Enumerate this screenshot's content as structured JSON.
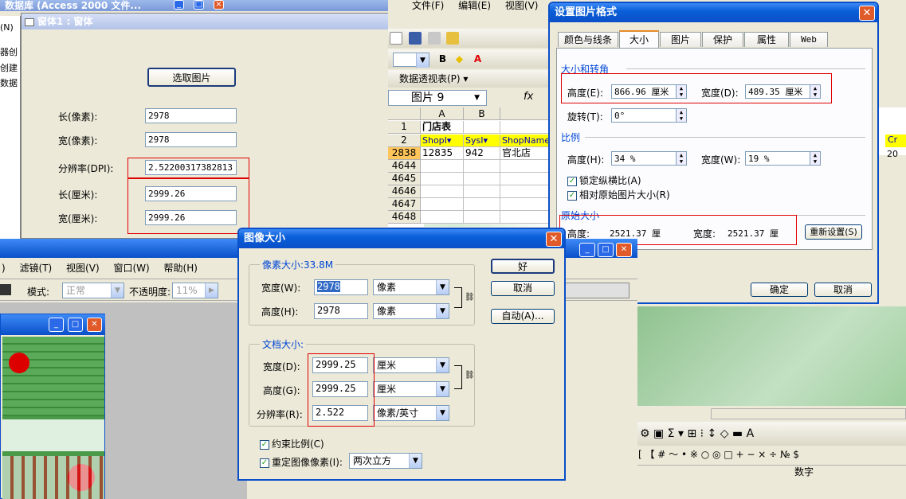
{
  "access_title": "数据库 (Access 2000 文件...",
  "access_left_menu": [
    "(N)",
    "器创",
    "创建",
    "数据"
  ],
  "form": {
    "title": "窗体1 : 窗体",
    "pick_button": "选取图片",
    "fields": [
      {
        "label": "长(像素):",
        "value": "2978"
      },
      {
        "label": "宽(像素):",
        "value": "2978"
      },
      {
        "label": "分辨率(DPI):",
        "value": "2.52200317382813"
      },
      {
        "label": "长(厘米):",
        "value": "2999.26"
      },
      {
        "label": "宽(厘米):",
        "value": "2999.26"
      }
    ]
  },
  "excel": {
    "menu": [
      "文件(F)",
      "编辑(E)",
      "视图(V)"
    ],
    "pivot_label": "数据透视表(P)",
    "name_box": "图片 9",
    "fx": "fx",
    "columns": [
      "A",
      "B"
    ],
    "rows": [
      {
        "num": "1",
        "cells": [
          "门店表",
          "",
          ""
        ]
      },
      {
        "num": "2",
        "cells": [
          "ShopI▾",
          "SysI▾",
          "ShopName"
        ]
      },
      {
        "num": "2838",
        "cells": [
          "12835",
          "942",
          "官北店"
        ]
      },
      {
        "num": "4644",
        "cells": [
          "",
          "",
          ""
        ]
      },
      {
        "num": "4645",
        "cells": [
          "",
          "",
          ""
        ]
      },
      {
        "num": "4646",
        "cells": [
          "",
          "",
          ""
        ]
      },
      {
        "num": "4647",
        "cells": [
          "",
          "",
          ""
        ]
      },
      {
        "num": "4648",
        "cells": [
          "",
          "",
          ""
        ]
      }
    ],
    "status": "数字",
    "right_header": "Cr",
    "right_val": "20"
  },
  "format_dialog": {
    "title": "设置图片格式",
    "tabs": [
      "颜色与线条",
      "大小",
      "图片",
      "保护",
      "属性",
      "Web"
    ],
    "active_tab": "大小",
    "size_group": "大小和转角",
    "height_label": "高度(E):",
    "height_value": "866.96 厘米",
    "width_label": "宽度(D):",
    "width_value": "489.35 厘米",
    "rotate_label": "旋转(T):",
    "rotate_value": "0°",
    "scale_group": "比例",
    "scale_height_label": "高度(H):",
    "scale_height_value": "34 %",
    "scale_width_label": "宽度(W):",
    "scale_width_value": "19 %",
    "lock_ratio": "锁定纵横比(A)",
    "relative_orig": "相对原始图片大小(R)",
    "orig_group": "原始大小",
    "orig_height_label": "高度:",
    "orig_height_value": "2521.37 厘",
    "orig_width_label": "宽度:",
    "orig_width_value": "2521.37 厘",
    "reset_button": "重新设置(S)",
    "ok_button": "确定",
    "cancel_button": "取消"
  },
  "ps": {
    "menu": [
      ")",
      "滤镜(T)",
      "视图(V)",
      "窗口(W)",
      "帮助(H)"
    ],
    "mode_label": "模式:",
    "mode_value": "正常",
    "opacity_label": "不透明度:",
    "opacity_value": "11%"
  },
  "image_dialog": {
    "title": "图像大小",
    "pixel_group": "像素大小:33.8M",
    "px_width_label": "宽度(W):",
    "px_width_value": "2978",
    "px_width_unit": "像素",
    "px_height_label": "高度(H):",
    "px_height_value": "2978",
    "px_height_unit": "像素",
    "doc_group": "文档大小:",
    "doc_width_label": "宽度(D):",
    "doc_width_value": "2999.25",
    "doc_width_unit": "厘米",
    "doc_height_label": "高度(G):",
    "doc_height_value": "2999.25",
    "doc_height_unit": "厘米",
    "res_label": "分辨率(R):",
    "res_value": "2.522",
    "res_unit": "像素/英寸",
    "constrain": "约束比例(C)",
    "resample": "重定图像像素(I):",
    "resample_method": "两次立方",
    "ok_button": "好",
    "cancel_button": "取消",
    "auto_button": "自动(A)..."
  },
  "colors": {
    "title_blue": "#0a5fd8",
    "red_highlight": "#e00000",
    "dialog_bg": "#ece9d8",
    "image_green": "#4a9a4a"
  }
}
